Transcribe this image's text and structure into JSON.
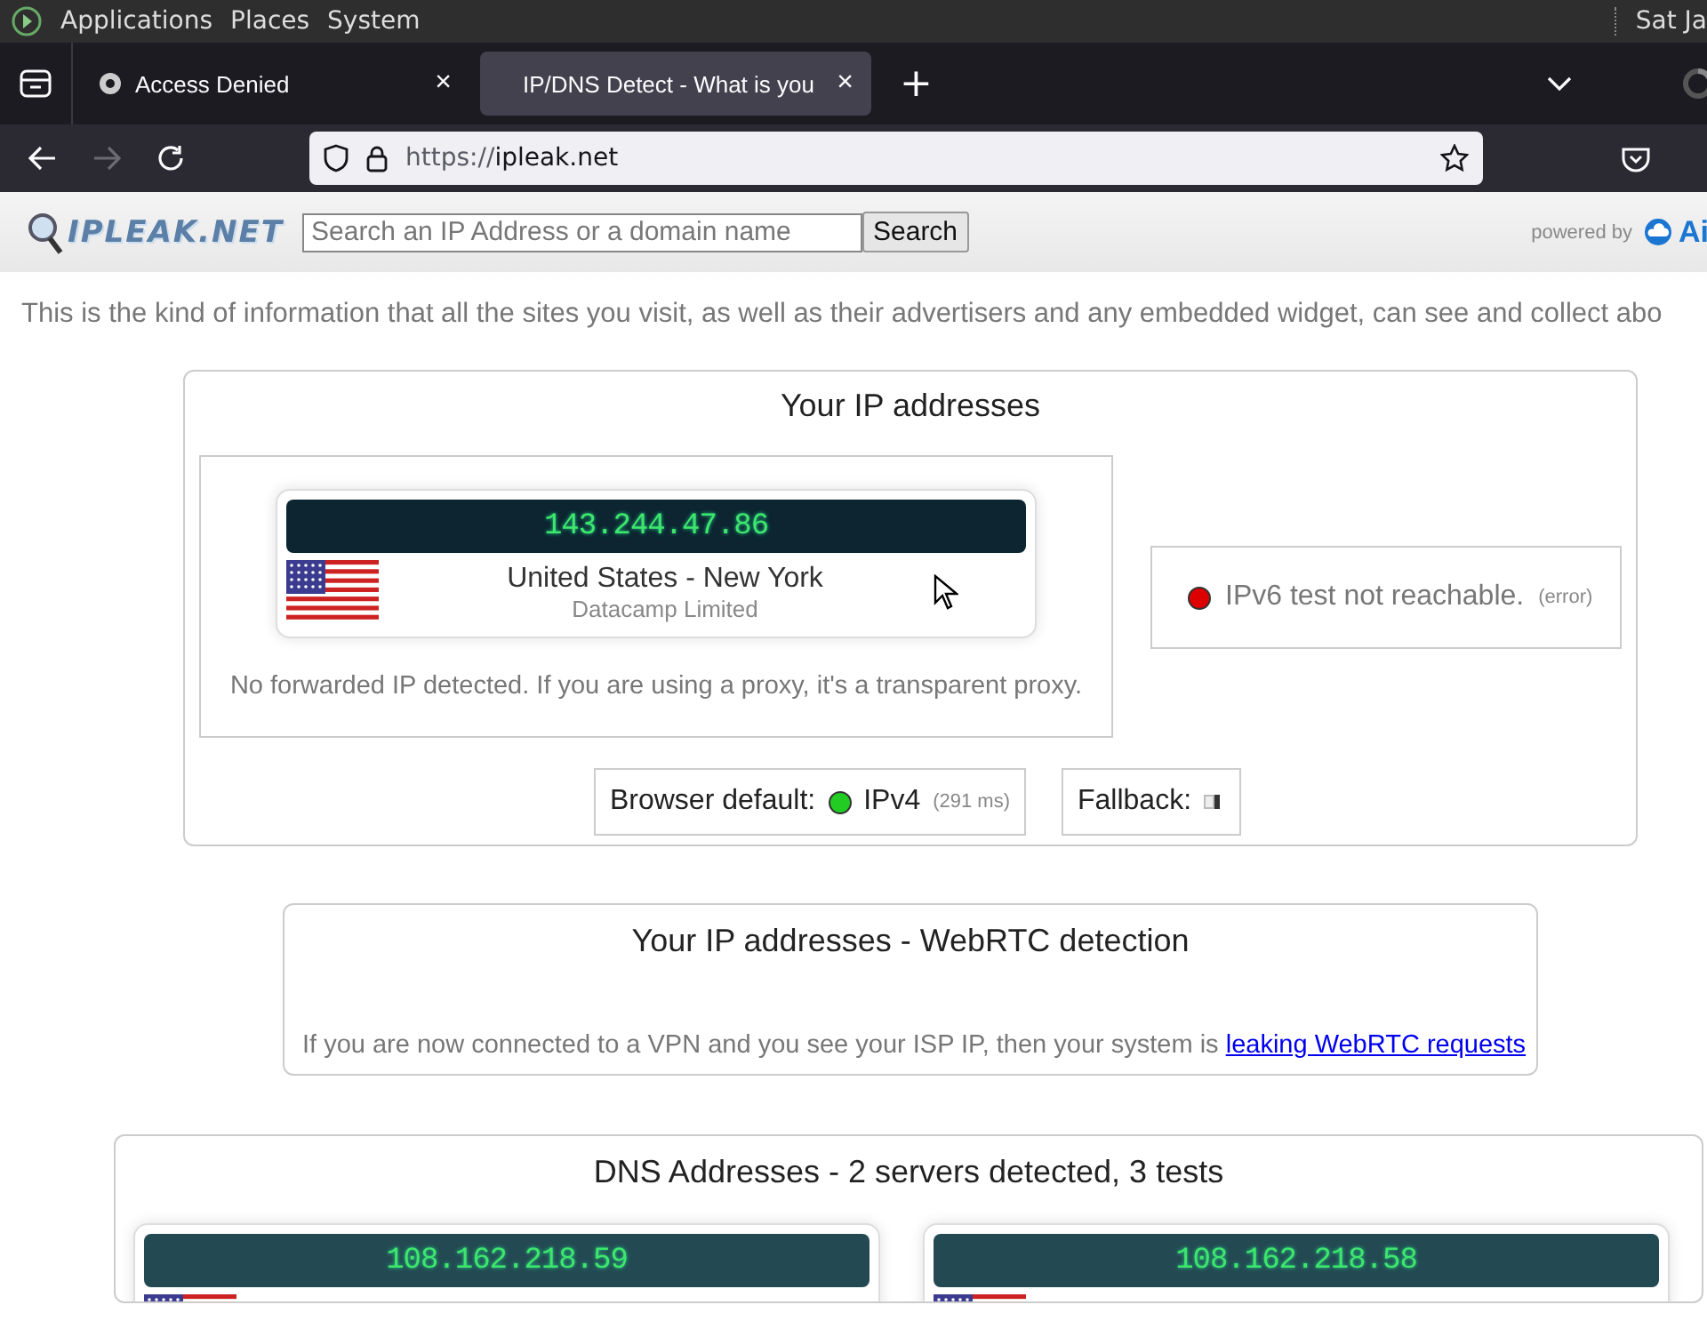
{
  "desktop_panel": {
    "menus": [
      "Applications",
      "Places",
      "System"
    ],
    "clock": "Sat Ja"
  },
  "browser": {
    "tabs": [
      {
        "title": "Access Denied",
        "close": "×",
        "selected": false
      },
      {
        "title": "IP/DNS Detect - What is you",
        "close": "×",
        "selected": true
      }
    ],
    "new_tab": "+",
    "url_scheme": "https://",
    "url_host": "ipleak.net",
    "forward_disabled": true
  },
  "site": {
    "logo": "IPLEAK.NET",
    "search": {
      "placeholder": "Search an IP Address or a domain name",
      "button": "Search"
    },
    "powered_by": "powered by",
    "sponsor": "Ai",
    "intro": "This is the kind of information that all the sites you visit, as well as their advertisers and any embedded widget, can see and collect abo"
  },
  "ip_section": {
    "title": "Your IP addresses",
    "ip": "143.244.47.86",
    "location": "United States - New York",
    "isp": "Datacamp Limited",
    "note": "No forwarded IP detected. If you are using a proxy, it's a transparent proxy.",
    "ipv6": {
      "text": "IPv6 test not reachable.",
      "detail": "(error)",
      "color": "#dd0000"
    },
    "browser_default": {
      "label": "Browser default:",
      "color": "#22cc22",
      "value": "IPv4",
      "detail": "(291 ms)"
    },
    "fallback": {
      "label": "Fallback:"
    }
  },
  "webrtc": {
    "title": "Your IP addresses - WebRTC detection",
    "note": "If you are now connected to a VPN and you see your ISP IP, then your system is",
    "link": "leaking WebRTC requests"
  },
  "dns": {
    "title": "DNS Addresses - 2 servers detected, 3 tests",
    "servers": [
      {
        "ip": "108.162.218.59"
      },
      {
        "ip": "108.162.218.58"
      }
    ]
  }
}
